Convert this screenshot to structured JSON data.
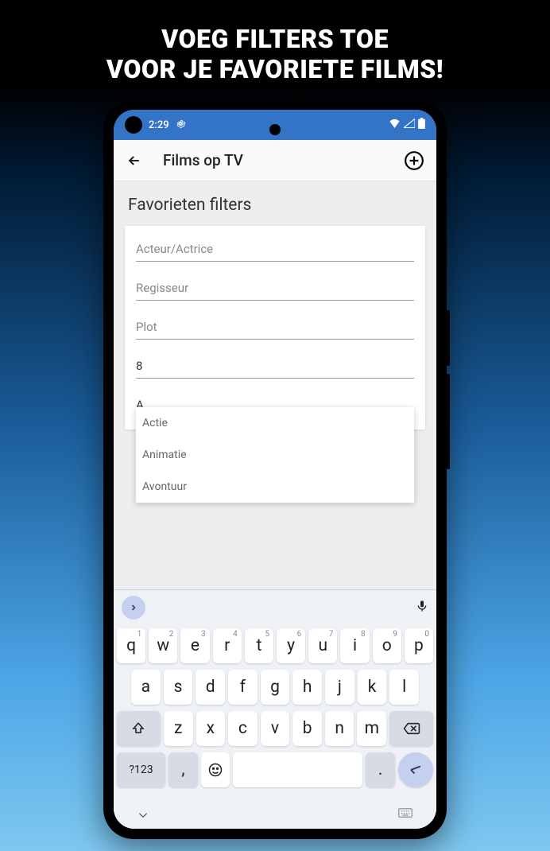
{
  "promo": {
    "line1": "VOEG FILTERS TOE",
    "line2": "VOOR JE FAVORIETE FILMS!"
  },
  "status_bar": {
    "time": "2:29"
  },
  "app_bar": {
    "title": "Films op TV"
  },
  "page": {
    "title": "Favorieten filters"
  },
  "fields": {
    "actor_placeholder": "Acteur/Actrice",
    "director_placeholder": "Regisseur",
    "plot_placeholder": "Plot",
    "rating_value": "8",
    "genre_value": "A"
  },
  "dropdown": {
    "items": [
      "Actie",
      "Animatie",
      "Avontuur"
    ]
  },
  "keyboard": {
    "row1": [
      {
        "k": "q",
        "h": "1"
      },
      {
        "k": "w",
        "h": "2"
      },
      {
        "k": "e",
        "h": "3"
      },
      {
        "k": "r",
        "h": "4"
      },
      {
        "k": "t",
        "h": "5"
      },
      {
        "k": "y",
        "h": "6"
      },
      {
        "k": "u",
        "h": "7"
      },
      {
        "k": "i",
        "h": "8"
      },
      {
        "k": "o",
        "h": "9"
      },
      {
        "k": "p",
        "h": "0"
      }
    ],
    "row2": [
      "a",
      "s",
      "d",
      "f",
      "g",
      "h",
      "j",
      "k",
      "l"
    ],
    "row3": [
      "z",
      "x",
      "c",
      "v",
      "b",
      "n",
      "m"
    ],
    "mode_key": "?123",
    "comma": ",",
    "period": "."
  }
}
